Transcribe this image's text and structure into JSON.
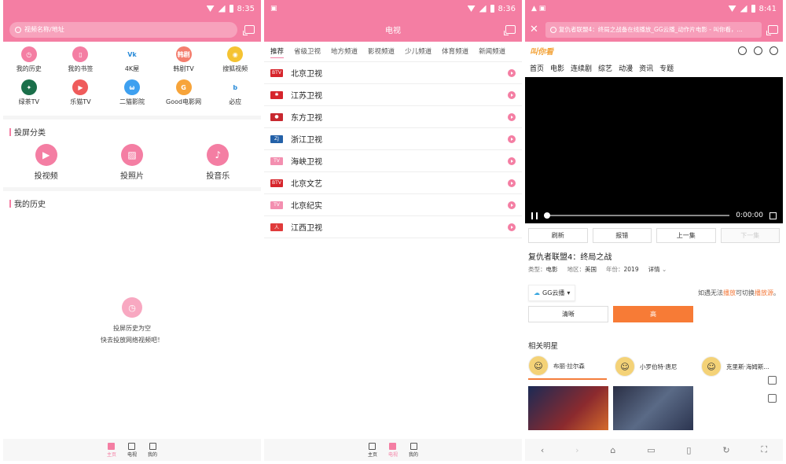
{
  "screen1": {
    "status": {
      "time": "8:35"
    },
    "search": {
      "placeholder": "视频名称/地址"
    },
    "apps": [
      {
        "label": "我的历史",
        "icon": "clock-icon",
        "color": "#f47ea3",
        "glyph": "◷"
      },
      {
        "label": "我的书签",
        "icon": "bookmark-icon",
        "color": "#f47ea3",
        "glyph": "▯"
      },
      {
        "label": "4K屋",
        "icon": "4k-logo-icon",
        "color": "#ffffff",
        "glyph": "Vk"
      },
      {
        "label": "韩剧TV",
        "icon": "hanju-logo-icon",
        "color": "#f47e6e",
        "glyph": "韩剧"
      },
      {
        "label": "搜狐视频",
        "icon": "sohu-logo-icon",
        "color": "#f5c332",
        "glyph": "◉"
      },
      {
        "label": "绿茶TV",
        "icon": "starbucks-logo-icon",
        "color": "#1a6f4a",
        "glyph": "✦"
      },
      {
        "label": "乐猫TV",
        "icon": "play-circle-icon",
        "color": "#ef5b5b",
        "glyph": "▶"
      },
      {
        "label": "二猫影院",
        "icon": "cat-logo-icon",
        "color": "#3ea0f0",
        "glyph": "ω"
      },
      {
        "label": "Good电影网",
        "icon": "good-logo-icon",
        "color": "#f7a43a",
        "glyph": "G"
      },
      {
        "label": "必应",
        "icon": "bing-logo-icon",
        "color": "#ffffff",
        "glyph": "b"
      }
    ],
    "cast_section_title": "投屏分类",
    "cast_items": [
      {
        "label": "投视频",
        "icon": "video-icon",
        "glyph": "▶"
      },
      {
        "label": "投照片",
        "icon": "photo-icon",
        "glyph": "▨"
      },
      {
        "label": "投音乐",
        "icon": "music-icon",
        "glyph": "♪"
      }
    ],
    "history_title": "我的历史",
    "empty_line1": "投屏历史为空",
    "empty_line2": "快去投放网络视频吧！",
    "nav": [
      {
        "label": "主页",
        "active": true
      },
      {
        "label": "电视",
        "active": false
      },
      {
        "label": "我的",
        "active": false
      }
    ]
  },
  "screen2": {
    "status": {
      "time": "8:36"
    },
    "title": "电视",
    "tabs": [
      "推荐",
      "省级卫视",
      "地方频道",
      "影视频道",
      "少儿频道",
      "体育频道",
      "新闻频道"
    ],
    "channels": [
      {
        "name": "北京卫视",
        "logo_color": "#d6252c",
        "logo_text": "BTV"
      },
      {
        "name": "江苏卫视",
        "logo_color": "#d6252c",
        "logo_text": "✱"
      },
      {
        "name": "东方卫视",
        "logo_color": "#c8282f",
        "logo_text": "●"
      },
      {
        "name": "浙江卫视",
        "logo_color": "#2461a8",
        "logo_text": "ZJ"
      },
      {
        "name": "海峡卫视",
        "logo_color": "#f38fb0",
        "logo_text": "TV"
      },
      {
        "name": "北京文艺",
        "logo_color": "#d6252c",
        "logo_text": "BTV"
      },
      {
        "name": "北京纪实",
        "logo_color": "#f38fb0",
        "logo_text": "TV"
      },
      {
        "name": "江西卫视",
        "logo_color": "#e03b3b",
        "logo_text": "人"
      }
    ],
    "nav": [
      {
        "label": "主页",
        "active": false
      },
      {
        "label": "电视",
        "active": true
      },
      {
        "label": "我的",
        "active": false
      }
    ]
  },
  "screen3": {
    "status": {
      "time": "8:41"
    },
    "url": "复仇者联盟4：终局之战备在线播放_GG云播_动作片电影 - 叫你看，...",
    "site_logo": "叫你看",
    "site_nav": [
      "首页",
      "电影",
      "连续剧",
      "综艺",
      "动漫",
      "资讯",
      "专题"
    ],
    "video": {
      "time": "0:00:00"
    },
    "actions": [
      "刷新",
      "报错",
      "上一集",
      "下一集"
    ],
    "movie_title": "复仇者联盟4：终局之战",
    "meta": {
      "type_label": "类型：",
      "type": "电影",
      "region_label": "地区：",
      "region": "美国",
      "year_label": "年份：",
      "year": "2019",
      "detail": "详情"
    },
    "source": "GG云播",
    "source_note_pre": "如遇无法",
    "source_note_hl1": "播放",
    "source_note_mid": "可切换",
    "source_note_hl2": "播放源",
    "source_note_post": "。",
    "qualities": [
      "清晰",
      "高"
    ],
    "stars_title": "相关明星",
    "stars": [
      "布丽·拉尔森",
      "小罗伯特·唐尼",
      "克里斯·海姆斯..."
    ]
  }
}
